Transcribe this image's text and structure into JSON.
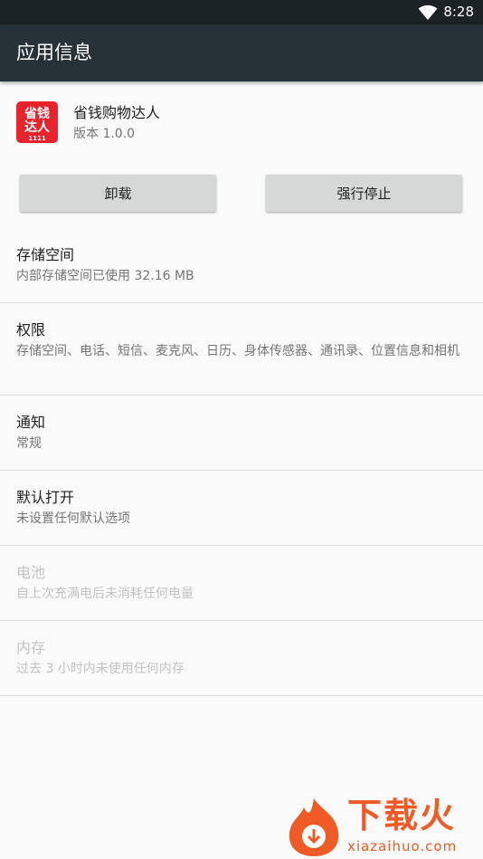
{
  "status_bar": {
    "time": "8:28",
    "wifi_icon": "wifi-icon"
  },
  "app_bar": {
    "title": "应用信息"
  },
  "app": {
    "icon_text_top": "省钱",
    "icon_text_bottom": "达人",
    "icon_badge": "1111",
    "name": "省钱购物达人",
    "version": "版本 1.0.0"
  },
  "buttons": {
    "uninstall": "卸载",
    "force_stop": "强行停止"
  },
  "items": [
    {
      "title": "存储空间",
      "subtitle": "内部存储空间已使用 32.16 MB"
    },
    {
      "title": "权限",
      "subtitle": "存储空间、电话、短信、麦克风、日历、身体传感器、通讯录、位置信息和相机"
    },
    {
      "title": "通知",
      "subtitle": "常规"
    },
    {
      "title": "默认打开",
      "subtitle": "未设置任何默认选项"
    },
    {
      "title": "电池",
      "subtitle": "自上次充满电后未消耗任何电量"
    },
    {
      "title": "内存",
      "subtitle": "过去 3 小时内未使用任何内存"
    }
  ],
  "watermark": {
    "text": "下载火",
    "sub": "xiazaihuo.com"
  },
  "colors": {
    "app_bar": "#263238",
    "status_bar": "#1c2326",
    "icon_red": "#e8232b",
    "watermark": "#f05a24"
  }
}
